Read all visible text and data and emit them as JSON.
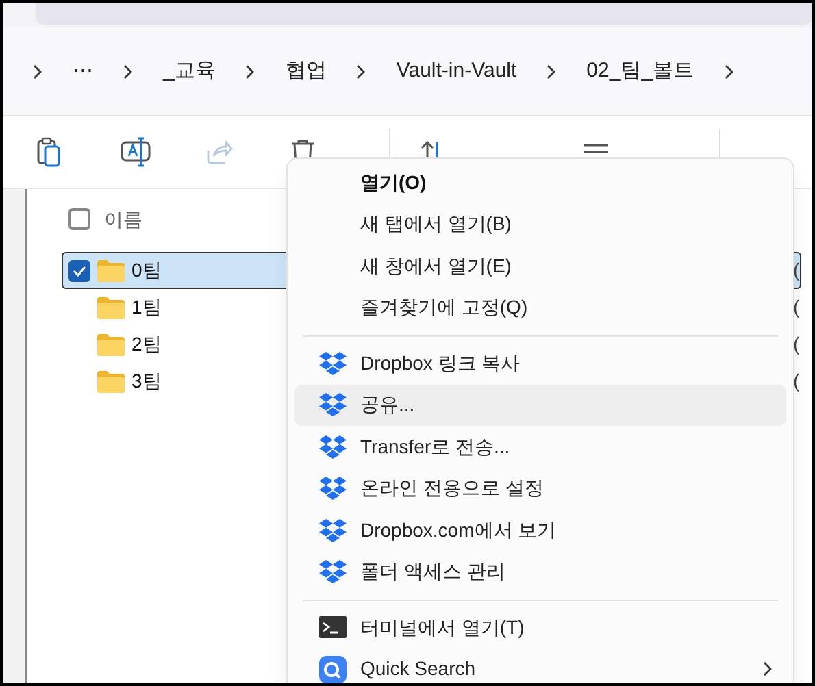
{
  "breadcrumb": {
    "items": [
      "⋯",
      "_교육",
      "협업",
      "Vault-in-Vault",
      "02_팀_볼트"
    ]
  },
  "toolbar": {
    "items": [
      {
        "kind": "copy",
        "disabled": false
      },
      {
        "kind": "rename",
        "disabled": false
      },
      {
        "kind": "share",
        "disabled": true
      },
      {
        "kind": "delete",
        "disabled": false
      },
      {
        "kind": "sort",
        "disabled": false
      },
      {
        "kind": "view",
        "disabled": false
      }
    ]
  },
  "file_list": {
    "header": {
      "label": "이름",
      "checked": false
    },
    "rows": [
      {
        "name": "0팀",
        "selected": true,
        "column_2": "("
      },
      {
        "name": "1팀",
        "selected": false,
        "column_2": "("
      },
      {
        "name": "2팀",
        "selected": false,
        "column_2": "("
      },
      {
        "name": "3팀",
        "selected": false,
        "column_2": "("
      }
    ]
  },
  "context_menu": {
    "items": [
      {
        "kind": "plain",
        "label": "열기(O)",
        "default": true,
        "hovered": false
      },
      {
        "kind": "plain",
        "label": "새 탭에서 열기(B)",
        "default": false,
        "hovered": false
      },
      {
        "kind": "plain",
        "label": "새 창에서 열기(E)",
        "default": false,
        "hovered": false
      },
      {
        "kind": "plain",
        "label": "즐겨찾기에 고정(Q)",
        "default": false,
        "hovered": false
      },
      {
        "kind": "separator"
      },
      {
        "kind": "dropbox",
        "label": "Dropbox 링크 복사",
        "default": false,
        "hovered": false
      },
      {
        "kind": "dropbox",
        "label": "공유...",
        "default": false,
        "hovered": true
      },
      {
        "kind": "dropbox",
        "label": "Transfer로 전송...",
        "default": false,
        "hovered": false
      },
      {
        "kind": "dropbox",
        "label": "온라인 전용으로 설정",
        "default": false,
        "hovered": false
      },
      {
        "kind": "dropbox",
        "label": "Dropbox.com에서 보기",
        "default": false,
        "hovered": false
      },
      {
        "kind": "dropbox",
        "label": "폴더 액세스 관리",
        "default": false,
        "hovered": false
      },
      {
        "kind": "separator"
      },
      {
        "kind": "terminal",
        "label": "터미널에서 열기(T)",
        "default": false,
        "hovered": false
      },
      {
        "kind": "quick-search",
        "label": "Quick Search",
        "default": false,
        "hovered": false,
        "submenu": true
      }
    ]
  }
}
